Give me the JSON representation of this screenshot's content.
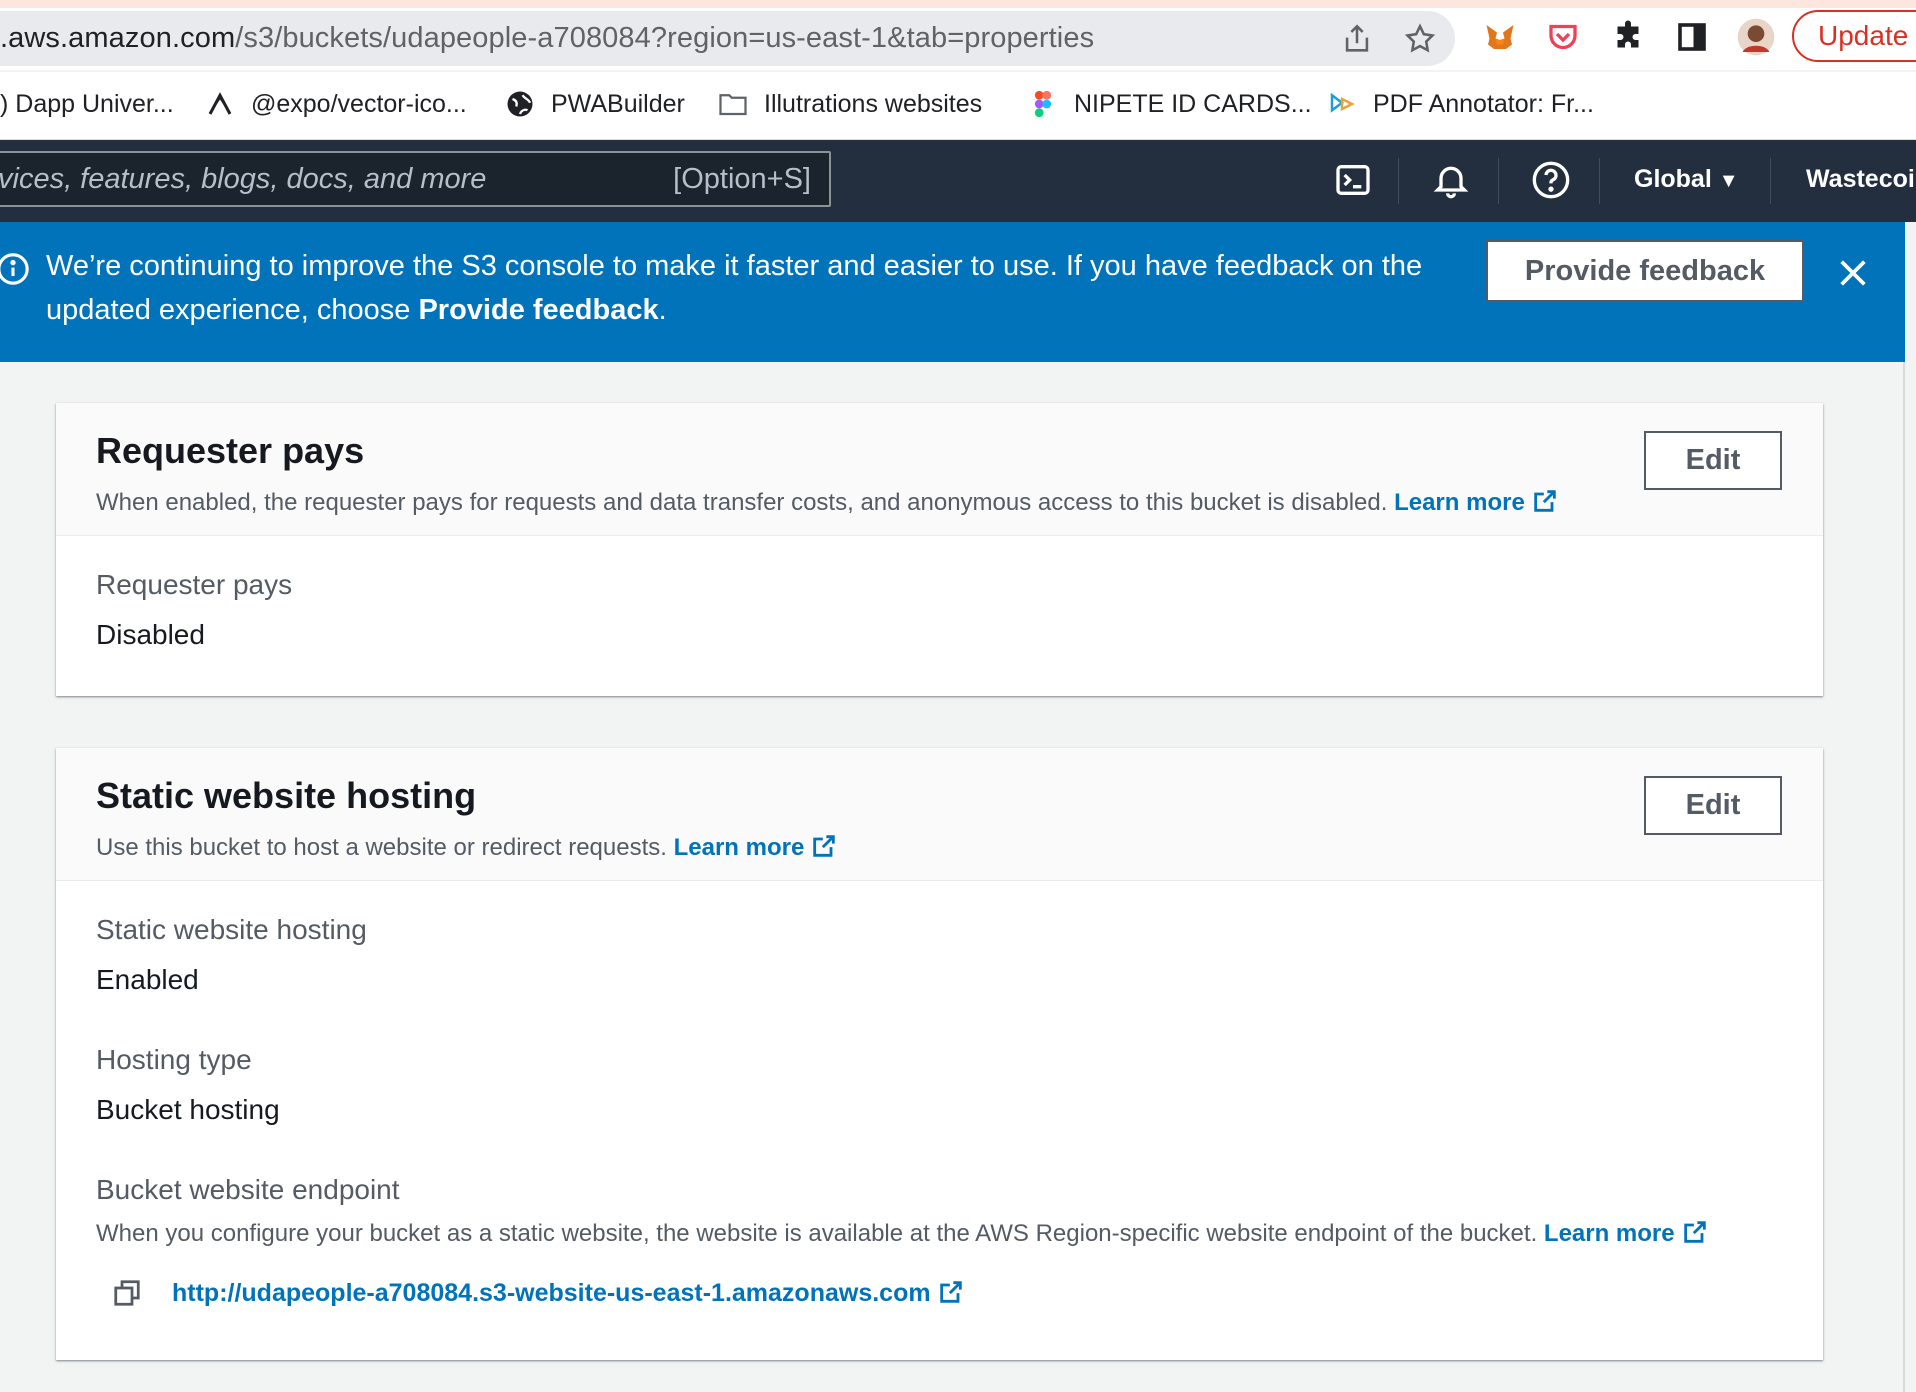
{
  "browser": {
    "url_host": ".aws.amazon.com",
    "url_path": "/s3/buckets/udapeople-a708084?region=us-east-1&tab=properties",
    "update_label": "Update",
    "bookmarks": [
      {
        "label": ") Dapp Univer..."
      },
      {
        "label": "@expo/vector-ico..."
      },
      {
        "label": "PWABuilder"
      },
      {
        "label": "Illutrations websites"
      },
      {
        "label": "NIPETE ID CARDS..."
      },
      {
        "label": "PDF Annotator: Fr..."
      }
    ]
  },
  "aws_nav": {
    "search_placeholder": "vices, features, blogs, docs, and more",
    "search_shortcut": "[Option+S]",
    "region": "Global",
    "account": "Wastecoin"
  },
  "flash": {
    "message_part1": "We’re continuing to improve the S3 console to make it faster and easier to use. If you have feedback on the updated experience, choose ",
    "message_bold": "Provide feedback",
    "message_end": ".",
    "feedback_button": "Provide feedback"
  },
  "requester_pays": {
    "title": "Requester pays",
    "description": "When enabled, the requester pays for requests and data transfer costs, and anonymous access to this bucket is disabled.",
    "learn_more": "Learn more",
    "edit_label": "Edit",
    "field_label": "Requester pays",
    "field_value": "Disabled"
  },
  "static_hosting": {
    "title": "Static website hosting",
    "description": "Use this bucket to host a website or redirect requests.",
    "learn_more": "Learn more",
    "edit_label": "Edit",
    "hosting_label": "Static website hosting",
    "hosting_value": "Enabled",
    "type_label": "Hosting type",
    "type_value": "Bucket hosting",
    "endpoint_label": "Bucket website endpoint",
    "endpoint_desc": "When you configure your bucket as a static website, the website is available at the AWS Region-specific website endpoint of the bucket.",
    "endpoint_learn_more": "Learn more",
    "endpoint_url": "http://udapeople-a708084.s3-website-us-east-1.amazonaws.com"
  },
  "colors": {
    "aws_nav_bg": "#232f3e",
    "flash_bg": "#0073bb",
    "link": "#0073bb",
    "update_red": "#d93025"
  }
}
